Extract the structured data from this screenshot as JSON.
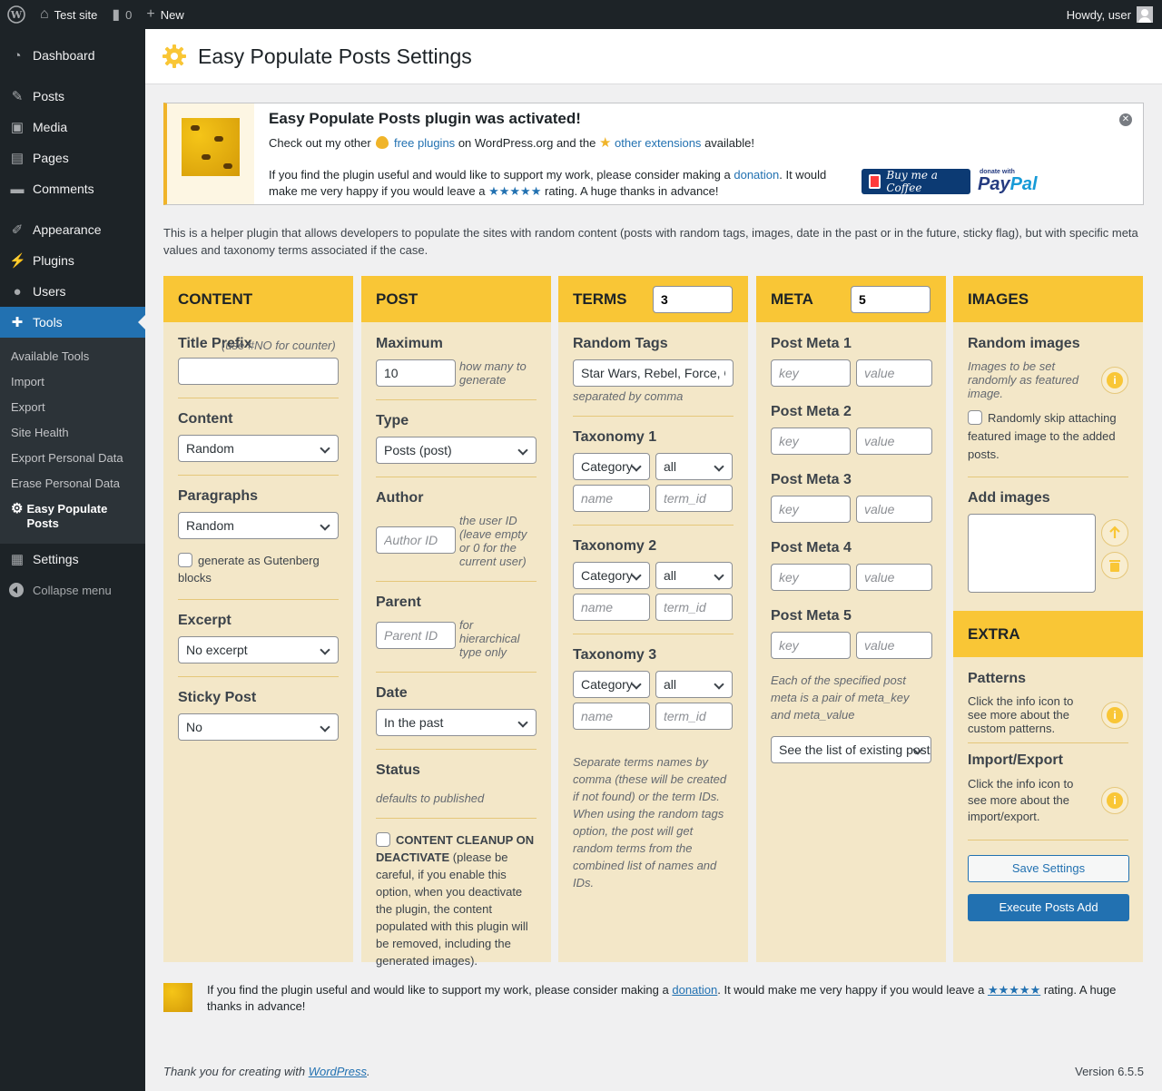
{
  "adminbar": {
    "site": "Test site",
    "comments_count": "0",
    "new_label": "New",
    "howdy": "Howdy, user"
  },
  "menu": {
    "dashboard": "Dashboard",
    "posts": "Posts",
    "media": "Media",
    "pages": "Pages",
    "comments": "Comments",
    "appearance": "Appearance",
    "plugins": "Plugins",
    "users": "Users",
    "tools": "Tools",
    "tools_sub": [
      "Available Tools",
      "Import",
      "Export",
      "Site Health",
      "Export Personal Data",
      "Erase Personal Data"
    ],
    "current_sub": "Easy Populate Posts",
    "settings": "Settings",
    "collapse": "Collapse menu"
  },
  "page": {
    "title": "Easy Populate Posts Settings"
  },
  "notice": {
    "title": "Easy Populate Posts plugin was activated!",
    "l1_a": "Check out my other",
    "l1_link1": "free plugins",
    "l1_b": "on WordPress.org and the",
    "l1_link2": "other extensions",
    "l1_c": "available!",
    "l2_a": "If you find the plugin useful and would like to support my work, please consider making a",
    "l2_link": "donation",
    "l2_b": ". It would make me very happy if you would leave a",
    "stars": "★★★★★",
    "l2_c": "rating. A huge thanks in advance!",
    "bmc": "Buy me a Coffee",
    "paypal_small": "donate with",
    "paypal_a": "Pay",
    "paypal_b": "Pal"
  },
  "intro": "This is a helper plugin that allows developers to populate the sites with random content (posts with random tags, images, date in the past or in the future, sticky flag), but with specific meta values and taxonomy terms associated if the case.",
  "content": {
    "header": "CONTENT",
    "title_prefix": "Title Prefix",
    "title_hint": "(use #NO for counter)",
    "content_label": "Content",
    "content_value": "Random",
    "paragraphs_label": "Paragraphs",
    "paragraphs_value": "Random",
    "gutenberg": "generate as Gutenberg blocks",
    "excerpt_label": "Excerpt",
    "excerpt_value": "No excerpt",
    "sticky_label": "Sticky Post",
    "sticky_value": "No"
  },
  "post": {
    "header": "POST",
    "maximum_label": "Maximum",
    "maximum_value": "10",
    "maximum_note": "how many to generate",
    "type_label": "Type",
    "type_value": "Posts (post)",
    "author_label": "Author",
    "author_placeholder": "Author ID",
    "author_note": "the user ID (leave empty or 0 for the current user)",
    "parent_label": "Parent",
    "parent_placeholder": "Parent ID",
    "parent_note": "for hierarchical type only",
    "date_label": "Date",
    "date_value": "In the past",
    "status_label": "Status",
    "status_note": "defaults to published",
    "cleanup_bold": "CONTENT CLEANUP ON DEACTIVATE",
    "cleanup_text": "(please be careful, if you enable this option, when you deactivate the plugin, the content populated with this plugin will be removed, including the generated images)."
  },
  "terms": {
    "header": "TERMS",
    "count": "3",
    "random_tags_label": "Random Tags",
    "random_tags_value": "Star Wars, Rebel, Force, Galaxy",
    "random_tags_note": "separated by comma",
    "tax1": "Taxonomy 1",
    "tax2": "Taxonomy 2",
    "tax3": "Taxonomy 3",
    "tax_select": "Category",
    "tax_scope": "all",
    "name_ph": "name",
    "termid_ph": "term_id",
    "note": "Separate terms names by comma (these will be created if not found) or the term IDs. When using the random tags option, the post will get random terms from the combined list of names and IDs."
  },
  "meta": {
    "header": "META",
    "count": "5",
    "m1": "Post Meta 1",
    "m2": "Post Meta 2",
    "m3": "Post Meta 3",
    "m4": "Post Meta 4",
    "m5": "Post Meta 5",
    "key_ph": "key",
    "value_ph": "value",
    "note": "Each of the specified post meta is a pair of meta_key and meta_value",
    "list_select": "See the list of existing post meta"
  },
  "images": {
    "header": "IMAGES",
    "random_label": "Random images",
    "random_note": "Images to be set randomly as featured image.",
    "skip": "Randomly skip attaching featured image to the added posts.",
    "add_label": "Add images"
  },
  "extra": {
    "header": "EXTRA",
    "patterns_label": "Patterns",
    "patterns_note": "Click the info icon to see more about the custom patterns.",
    "ie_label": "Import/Export",
    "ie_note": "Click the info icon to see more about the import/export.",
    "save": "Save Settings",
    "execute": "Execute Posts Add"
  },
  "support": {
    "a": "If you find the plugin useful and would like to support my work, please consider making a",
    "link": "donation",
    "b": ". It would make me very happy if you would leave a",
    "stars": "★★★★★",
    "c": "rating. A huge thanks in advance!"
  },
  "footer": {
    "thanks": "Thank you for creating with",
    "wp": "WordPress",
    "version": "Version 6.5.5"
  },
  "colors": {
    "accent": "#f9c636",
    "panel": "#f3e7c8",
    "admin_dark": "#1d2327",
    "primary": "#2271b1"
  }
}
